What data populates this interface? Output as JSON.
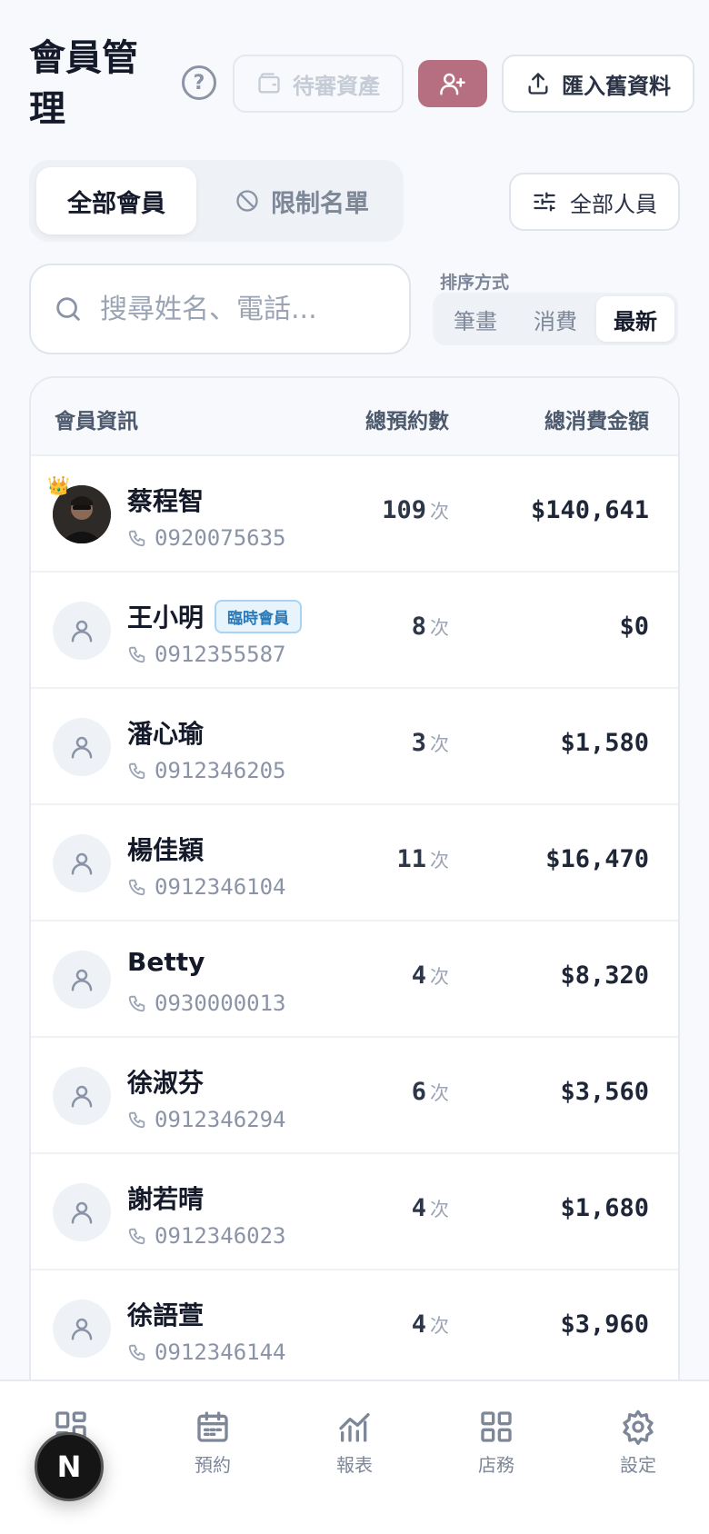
{
  "header": {
    "title": "會員管理",
    "help_icon": "help-circle-icon",
    "pending_label": "待審資產",
    "import_label": "匯入舊資料",
    "colors": {
      "accent": "#b66f80"
    }
  },
  "tabs": {
    "all_label": "全部會員",
    "restricted_label": "限制名單"
  },
  "filter": {
    "label": "全部人員"
  },
  "search": {
    "placeholder": "搜尋姓名、電話..."
  },
  "sort": {
    "label": "排序方式",
    "options": [
      "筆畫",
      "消費",
      "最新"
    ],
    "selected": "最新"
  },
  "table": {
    "headers": {
      "info": "會員資訊",
      "count": "總預約數",
      "amount": "總消費金額"
    },
    "unit": "次",
    "rows": [
      {
        "name": "蔡程智",
        "phone": "0920075635",
        "count": "109",
        "amount": "$140,641",
        "avatar": "photo",
        "tag": ""
      },
      {
        "name": "王小明",
        "phone": "0912355587",
        "count": "8",
        "amount": "$0",
        "avatar": "user-icon",
        "tag": "臨時會員"
      },
      {
        "name": "潘心瑜",
        "phone": "0912346205",
        "count": "3",
        "amount": "$1,580",
        "avatar": "user-icon",
        "tag": ""
      },
      {
        "name": "楊佳穎",
        "phone": "0912346104",
        "count": "11",
        "amount": "$16,470",
        "avatar": "user-icon",
        "tag": ""
      },
      {
        "name": "Betty",
        "phone": "0930000013",
        "count": "4",
        "amount": "$8,320",
        "avatar": "user-icon",
        "tag": ""
      },
      {
        "name": "徐淑芬",
        "phone": "0912346294",
        "count": "6",
        "amount": "$3,560",
        "avatar": "user-icon",
        "tag": ""
      },
      {
        "name": "謝若晴",
        "phone": "0912346023",
        "count": "4",
        "amount": "$1,680",
        "avatar": "user-icon",
        "tag": ""
      },
      {
        "name": "徐語萱",
        "phone": "0912346144",
        "count": "4",
        "amount": "$3,960",
        "avatar": "user-icon",
        "tag": ""
      }
    ]
  },
  "nav": {
    "items": [
      {
        "label": "",
        "icon": "dashboard-icon"
      },
      {
        "label": "預約",
        "icon": "calendar-icon"
      },
      {
        "label": "報表",
        "icon": "chart-icon"
      },
      {
        "label": "店務",
        "icon": "grid-icon"
      },
      {
        "label": "設定",
        "icon": "gear-icon"
      }
    ]
  },
  "fab": {
    "label": "N"
  }
}
